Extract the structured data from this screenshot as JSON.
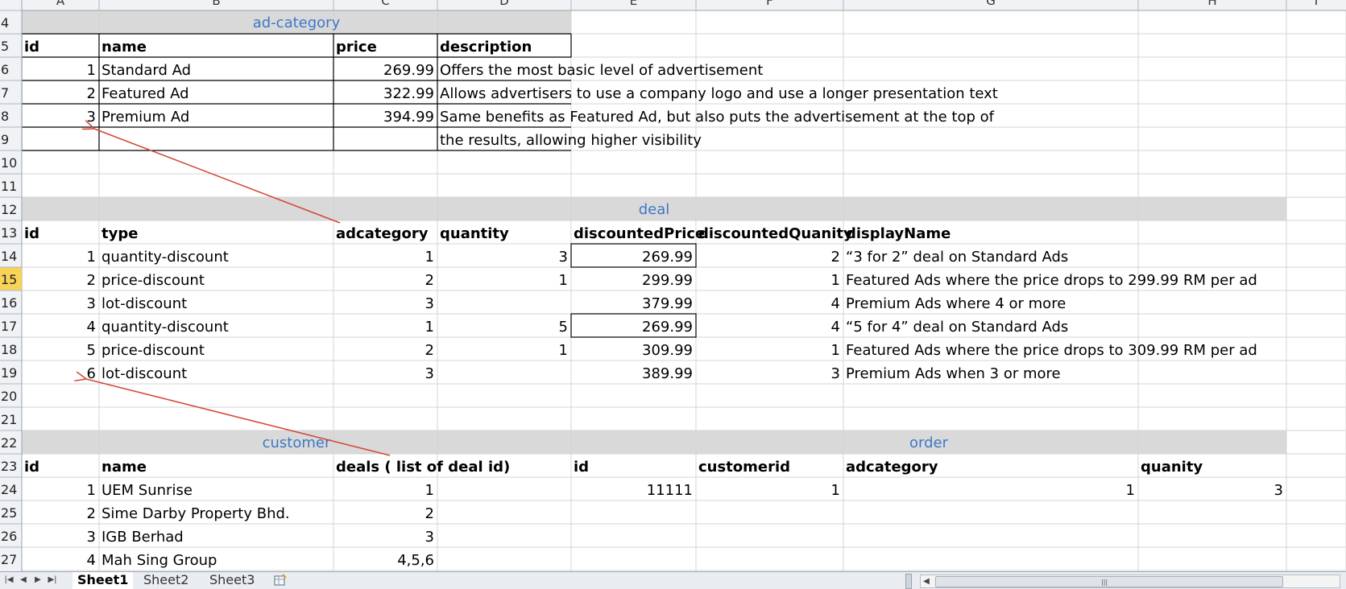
{
  "colors": {
    "header_fill": "#d9d9d9",
    "section_title": "#3c78c8",
    "grid": "#d4d4d4",
    "row_active": "#f7d35a",
    "arrow": "#d24a3c"
  },
  "columns": [
    "A",
    "B",
    "C",
    "D",
    "E",
    "F",
    "G",
    "H",
    "I"
  ],
  "rows": [
    "4",
    "5",
    "6",
    "7",
    "8",
    "9",
    "10",
    "11",
    "12",
    "13",
    "14",
    "15",
    "16",
    "17",
    "18",
    "19",
    "20",
    "21",
    "22",
    "23",
    "24",
    "25",
    "26",
    "27"
  ],
  "active_row": "15",
  "sections": {
    "ad_category": "ad-category",
    "deal": "deal",
    "customer": "customer",
    "order": "order"
  },
  "ad_category": {
    "headers": [
      "id",
      "name",
      "price",
      "description"
    ],
    "rows": [
      [
        "1",
        "Standard Ad",
        "269.99",
        "Offers the most basic level of advertisement"
      ],
      [
        "2",
        "Featured Ad",
        "322.99",
        "Allows advertisers to use a company logo and use a longer presentation text"
      ],
      [
        "3",
        "Premium Ad",
        "394.99",
        "Same benefits as Featured Ad, but also puts the advertisement at the top of"
      ]
    ],
    "continuation": "the results, allowing higher visibility"
  },
  "deal": {
    "headers": [
      "id",
      "type",
      "adcategory",
      "quantity",
      "discountedPrice",
      "discountedQuanity",
      "displayName"
    ],
    "rows": [
      [
        "1",
        "quantity-discount",
        "1",
        "3",
        "269.99",
        "2",
        "“3 for 2” deal on Standard Ads"
      ],
      [
        "2",
        "price-discount",
        "2",
        "1",
        "299.99",
        "1",
        "Featured Ads where the price drops to 299.99 RM per ad"
      ],
      [
        "3",
        "lot-discount",
        "3",
        "",
        "379.99",
        "4",
        "Premium Ads where 4 or more"
      ],
      [
        "4",
        "quantity-discount",
        "1",
        "5",
        "269.99",
        "4",
        "“5 for 4” deal on Standard Ads"
      ],
      [
        "5",
        "price-discount",
        "2",
        "1",
        "309.99",
        "1",
        "Featured Ads where the price drops to 309.99 RM per ad"
      ],
      [
        "6",
        "lot-discount",
        "3",
        "",
        "389.99",
        "3",
        "Premium Ads when 3 or more"
      ]
    ]
  },
  "customer": {
    "headers": [
      "id",
      "name",
      "deals ( list of deal id)"
    ],
    "rows": [
      [
        "1",
        "UEM Sunrise",
        "1"
      ],
      [
        "2",
        "Sime Darby Property Bhd.",
        "2"
      ],
      [
        "3",
        "IGB Berhad",
        "3"
      ],
      [
        "4",
        "Mah Sing Group",
        "4,5,6"
      ]
    ]
  },
  "order": {
    "headers": [
      "id",
      "customerid",
      "adcategory",
      "quanity"
    ],
    "rows": [
      [
        "11111",
        "1",
        "1",
        "3"
      ]
    ]
  },
  "sheet_tabs": [
    "Sheet1",
    "Sheet2",
    "Sheet3"
  ],
  "active_tab": "Sheet1",
  "icons": {
    "nav_first": "first-sheet-icon",
    "nav_prev": "prev-sheet-icon",
    "nav_next": "next-sheet-icon",
    "nav_last": "last-sheet-icon",
    "insert": "insert-sheet-icon"
  }
}
